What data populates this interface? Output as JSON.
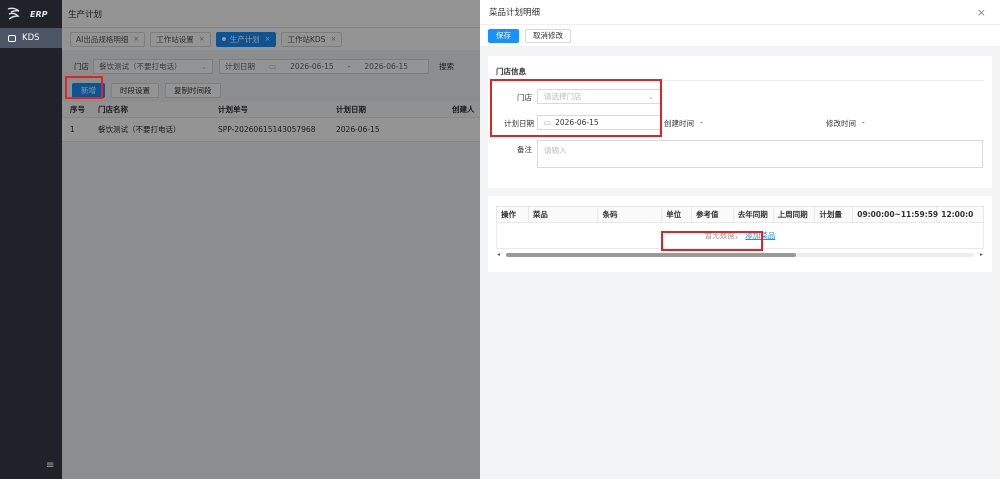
{
  "sidebar": {
    "logo_text": "ERP",
    "nav_item": "KDS",
    "menu_glyph": "≡"
  },
  "topbar": {
    "title": "生产计划"
  },
  "tabs": [
    {
      "label": "AI出品规格明细"
    },
    {
      "label": "工作站设置"
    },
    {
      "label": "生产计划"
    },
    {
      "label": "工作站KDS"
    }
  ],
  "filter": {
    "store_label": "门店",
    "store_value": "餐饮测试（不要打电话）",
    "date_label": "计划日期",
    "date_from": "2026-06-15",
    "date_sep": "-",
    "date_to": "2026-06-15",
    "search_label": "搜索"
  },
  "buttons": {
    "add": "新增",
    "slot_setting": "时段设置",
    "copy_slot": "复制时间段"
  },
  "table": {
    "headers": [
      "序号",
      "门店名称",
      "计划单号",
      "计划日期",
      "创建人"
    ],
    "rows": [
      [
        "1",
        "餐饮测试（不要打电话）",
        "SPP-20260615143057968",
        "2026-06-15",
        ""
      ]
    ]
  },
  "drawer": {
    "title": "菜品计划明细",
    "close": "×",
    "save": "保存",
    "cancel": "取消修改",
    "section": "门店信息",
    "store_label": "门店",
    "store_placeholder": "请选择门店",
    "date_label": "计划日期",
    "date_value": "2026-06-15",
    "created_label": "创建时间",
    "created_value": "-",
    "modified_label": "修改时间",
    "modified_value": "-",
    "remark_label": "备注",
    "remark_placeholder": "请输入",
    "dish_headers": [
      "操作",
      "菜品",
      "条码",
      "单位",
      "参考值",
      "去年同期",
      "上周同期",
      "计划量",
      "09:00:00~11:59:59",
      "12:00:0"
    ],
    "empty_text": "暂无数据，",
    "add_dish_link": "添加菜品"
  },
  "colors": {
    "primary": "#1890ff",
    "sidebar": "#1f2329",
    "highlight": "#e02424"
  }
}
